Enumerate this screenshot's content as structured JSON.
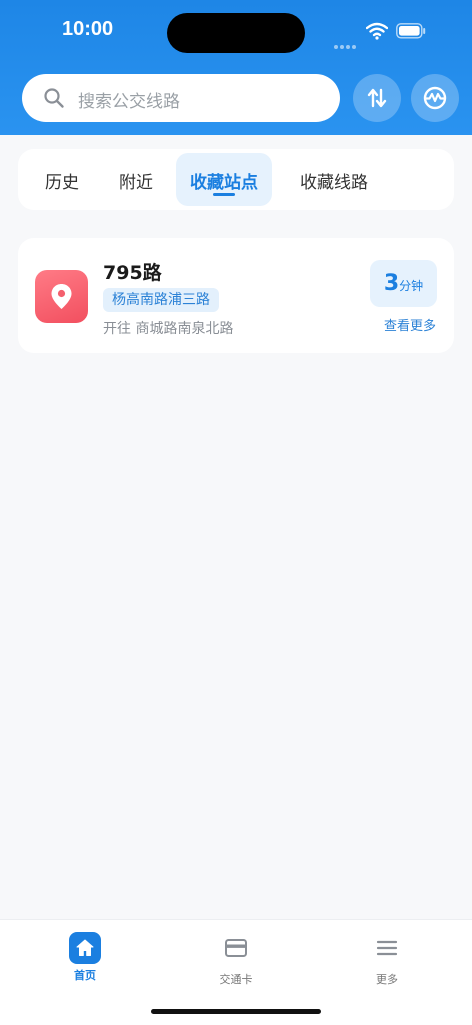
{
  "status_bar": {
    "time": "10:00"
  },
  "search": {
    "placeholder": "搜索公交线路"
  },
  "header_buttons": {
    "swap_icon": "swap-vertical-arrows-icon",
    "metro_icon": "metro-logo-icon"
  },
  "tabs": [
    {
      "label": "历史",
      "active": false
    },
    {
      "label": "附近",
      "active": false
    },
    {
      "label": "收藏站点",
      "active": true
    },
    {
      "label": "收藏线路",
      "active": false
    }
  ],
  "favorite_stops": [
    {
      "route": "795路",
      "stop": "杨高南路浦三路",
      "direction": "开往 商城路南泉北路",
      "eta_value": "3",
      "eta_unit": "分钟",
      "more_label": "查看更多",
      "icon": "location-pin-icon"
    }
  ],
  "bottom_nav": [
    {
      "label": "首页",
      "icon": "home-icon",
      "active": true
    },
    {
      "label": "交通卡",
      "icon": "card-icon",
      "active": false
    },
    {
      "label": "更多",
      "icon": "menu-icon",
      "active": false
    }
  ],
  "colors": {
    "brand_blue": "#1e86e6",
    "accent_blue": "#1b7fe0",
    "pin_red": "#f24f5f",
    "chip_bg": "#e3f0fc"
  }
}
